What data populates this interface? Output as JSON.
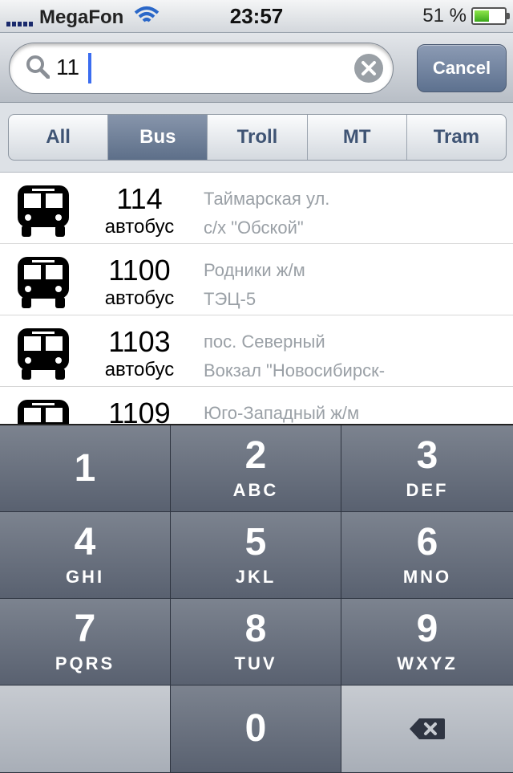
{
  "statusbar": {
    "carrier": "MegaFon",
    "time": "23:57",
    "battery": "51 %",
    "battery_level": 0.51
  },
  "search": {
    "value": "11",
    "cancel_label": "Cancel"
  },
  "filters": {
    "tabs": [
      {
        "label": "All",
        "active": false
      },
      {
        "label": "Bus",
        "active": true
      },
      {
        "label": "Troll",
        "active": false
      },
      {
        "label": "MT",
        "active": false
      },
      {
        "label": "Tram",
        "active": false
      }
    ]
  },
  "routes": [
    {
      "number": "114",
      "type": "автобус",
      "from": "Таймарская ул.",
      "to": "с/х \"Обской\""
    },
    {
      "number": "1100",
      "type": "автобус",
      "from": "Родники ж/м",
      "to": "ТЭЦ-5"
    },
    {
      "number": "1103",
      "type": "автобус",
      "from": "пос. Северный",
      "to": "Вокзал \"Новосибирск-"
    },
    {
      "number": "1109",
      "type": "",
      "from": "Юго-Западный ж/м",
      "to": ""
    }
  ],
  "keypad": {
    "keys": [
      {
        "digit": "1",
        "letters": ""
      },
      {
        "digit": "2",
        "letters": "ABC"
      },
      {
        "digit": "3",
        "letters": "DEF"
      },
      {
        "digit": "4",
        "letters": "GHI"
      },
      {
        "digit": "5",
        "letters": "JKL"
      },
      {
        "digit": "6",
        "letters": "MNO"
      },
      {
        "digit": "7",
        "letters": "PQRS"
      },
      {
        "digit": "8",
        "letters": "TUV"
      },
      {
        "digit": "9",
        "letters": "WXYZ"
      },
      {
        "digit": "0",
        "letters": ""
      }
    ]
  },
  "colors": {
    "accent": "#5d6f89",
    "caret": "#3b6df0"
  },
  "icons": {
    "route": "bus-icon",
    "search": "search-icon",
    "clear": "clear-icon",
    "backspace": "backspace-icon"
  }
}
